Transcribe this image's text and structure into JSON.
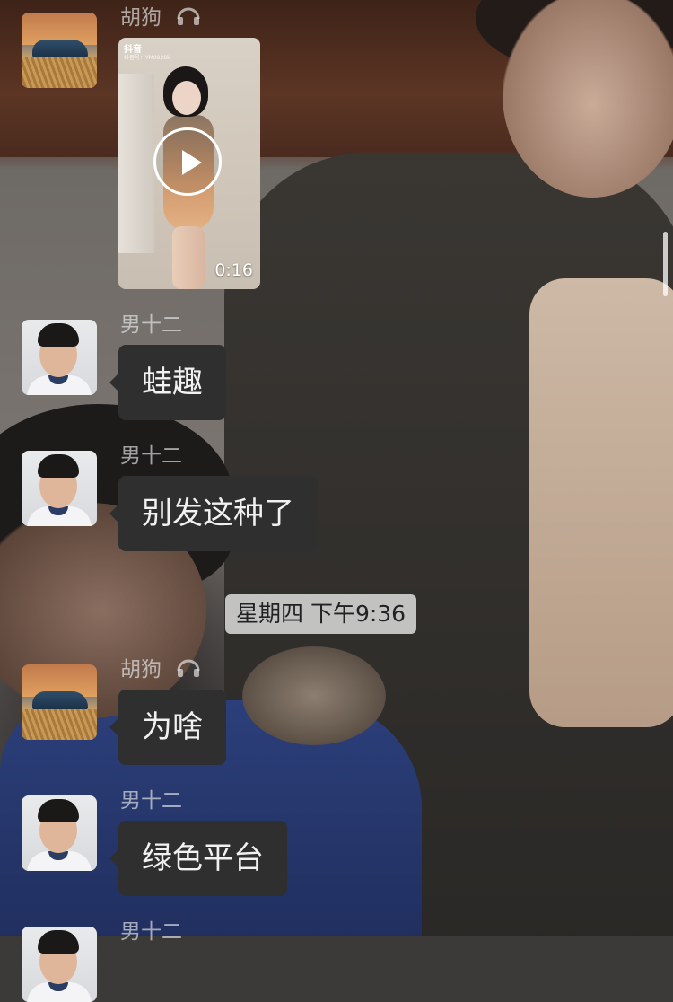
{
  "messages": [
    {
      "sender": "胡狗",
      "type": "video",
      "app_brand": "抖音",
      "app_sub": "抖音号：YM0928k",
      "duration": "0:16",
      "sender_icon": "headset-icon",
      "avatar": "car-avatar"
    },
    {
      "sender": "男十二",
      "type": "text",
      "text": "蛙趣",
      "avatar": "boy-avatar"
    },
    {
      "sender": "男十二",
      "type": "text",
      "text": "别发这种了",
      "avatar": "boy-avatar"
    },
    {
      "sender": "胡狗",
      "type": "text",
      "text": "为啥",
      "sender_icon": "headset-icon",
      "avatar": "car-avatar"
    },
    {
      "sender": "男十二",
      "type": "text",
      "text": "绿色平台",
      "avatar": "boy-avatar"
    },
    {
      "sender": "男十二",
      "type": "partial",
      "avatar": "boy-avatar"
    }
  ],
  "timestamp": "星期四 下午9:36",
  "colors": {
    "bubble": "#2f2f2f",
    "bubble_text": "#f1f1f1",
    "name_text": "#a7a7a7",
    "timestamp_bg": "#dcdcdc"
  }
}
